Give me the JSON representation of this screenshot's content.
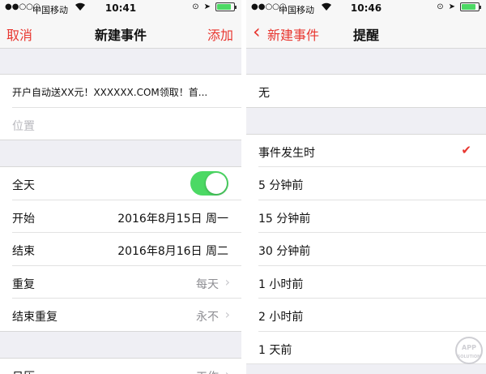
{
  "left": {
    "status": {
      "carrier": "中国移动",
      "time": "10:41"
    },
    "nav": {
      "cancel": "取消",
      "title": "新建事件",
      "add": "添加"
    },
    "event_title": "开户自动送XX元！XXXXXX.COM领取！首...",
    "location_placeholder": "位置",
    "all_day_label": "全天",
    "all_day_on": true,
    "start_label": "开始",
    "start_value": "2016年8月15日 周一",
    "end_label": "结束",
    "end_value": "2016年8月16日 周二",
    "repeat_label": "重复",
    "repeat_value": "每天",
    "end_repeat_label": "结束重复",
    "end_repeat_value": "永不",
    "calendar_label": "日历",
    "calendar_value": "工作"
  },
  "right": {
    "status": {
      "carrier": "中国移动",
      "time": "10:46"
    },
    "nav": {
      "back": "新建事件",
      "title": "提醒"
    },
    "none_option": "无",
    "options": [
      "事件发生时",
      "5 分钟前",
      "15 分钟前",
      "30 分钟前",
      "1 小时前",
      "2 小时前",
      "1 天前"
    ],
    "selected_index": 0
  },
  "watermark": {
    "line1": "APP",
    "line2": "SOLUTION"
  },
  "colors": {
    "accent": "#e8362f",
    "toggle_on": "#4cd964"
  }
}
